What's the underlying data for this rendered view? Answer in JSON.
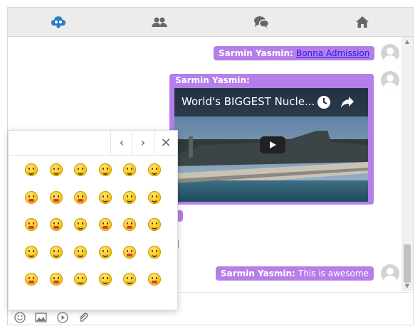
{
  "messages": [
    {
      "sender": "Sarmin Yasmin:",
      "link": "Bonna Admission"
    },
    {
      "sender": "Sarmin Yasmin:",
      "video_title": "World's BIGGEST Nucle..."
    },
    {
      "sender": "Sarmin Yasmin:",
      "text": "This is awesome"
    }
  ],
  "icons": {
    "tab_1": "cloud-users-icon",
    "tab_2": "users-icon",
    "tab_3": "chat-icon",
    "tab_4": "home-icon",
    "composer": [
      "emoji-icon",
      "image-icon",
      "video-icon",
      "attachment-icon"
    ]
  },
  "picker": {
    "prev": "‹",
    "next": "›",
    "close": "×"
  },
  "colors": {
    "bubble": "#b57ee8",
    "link": "#2a1ae3",
    "accent_tab": "#2b7ec4"
  }
}
